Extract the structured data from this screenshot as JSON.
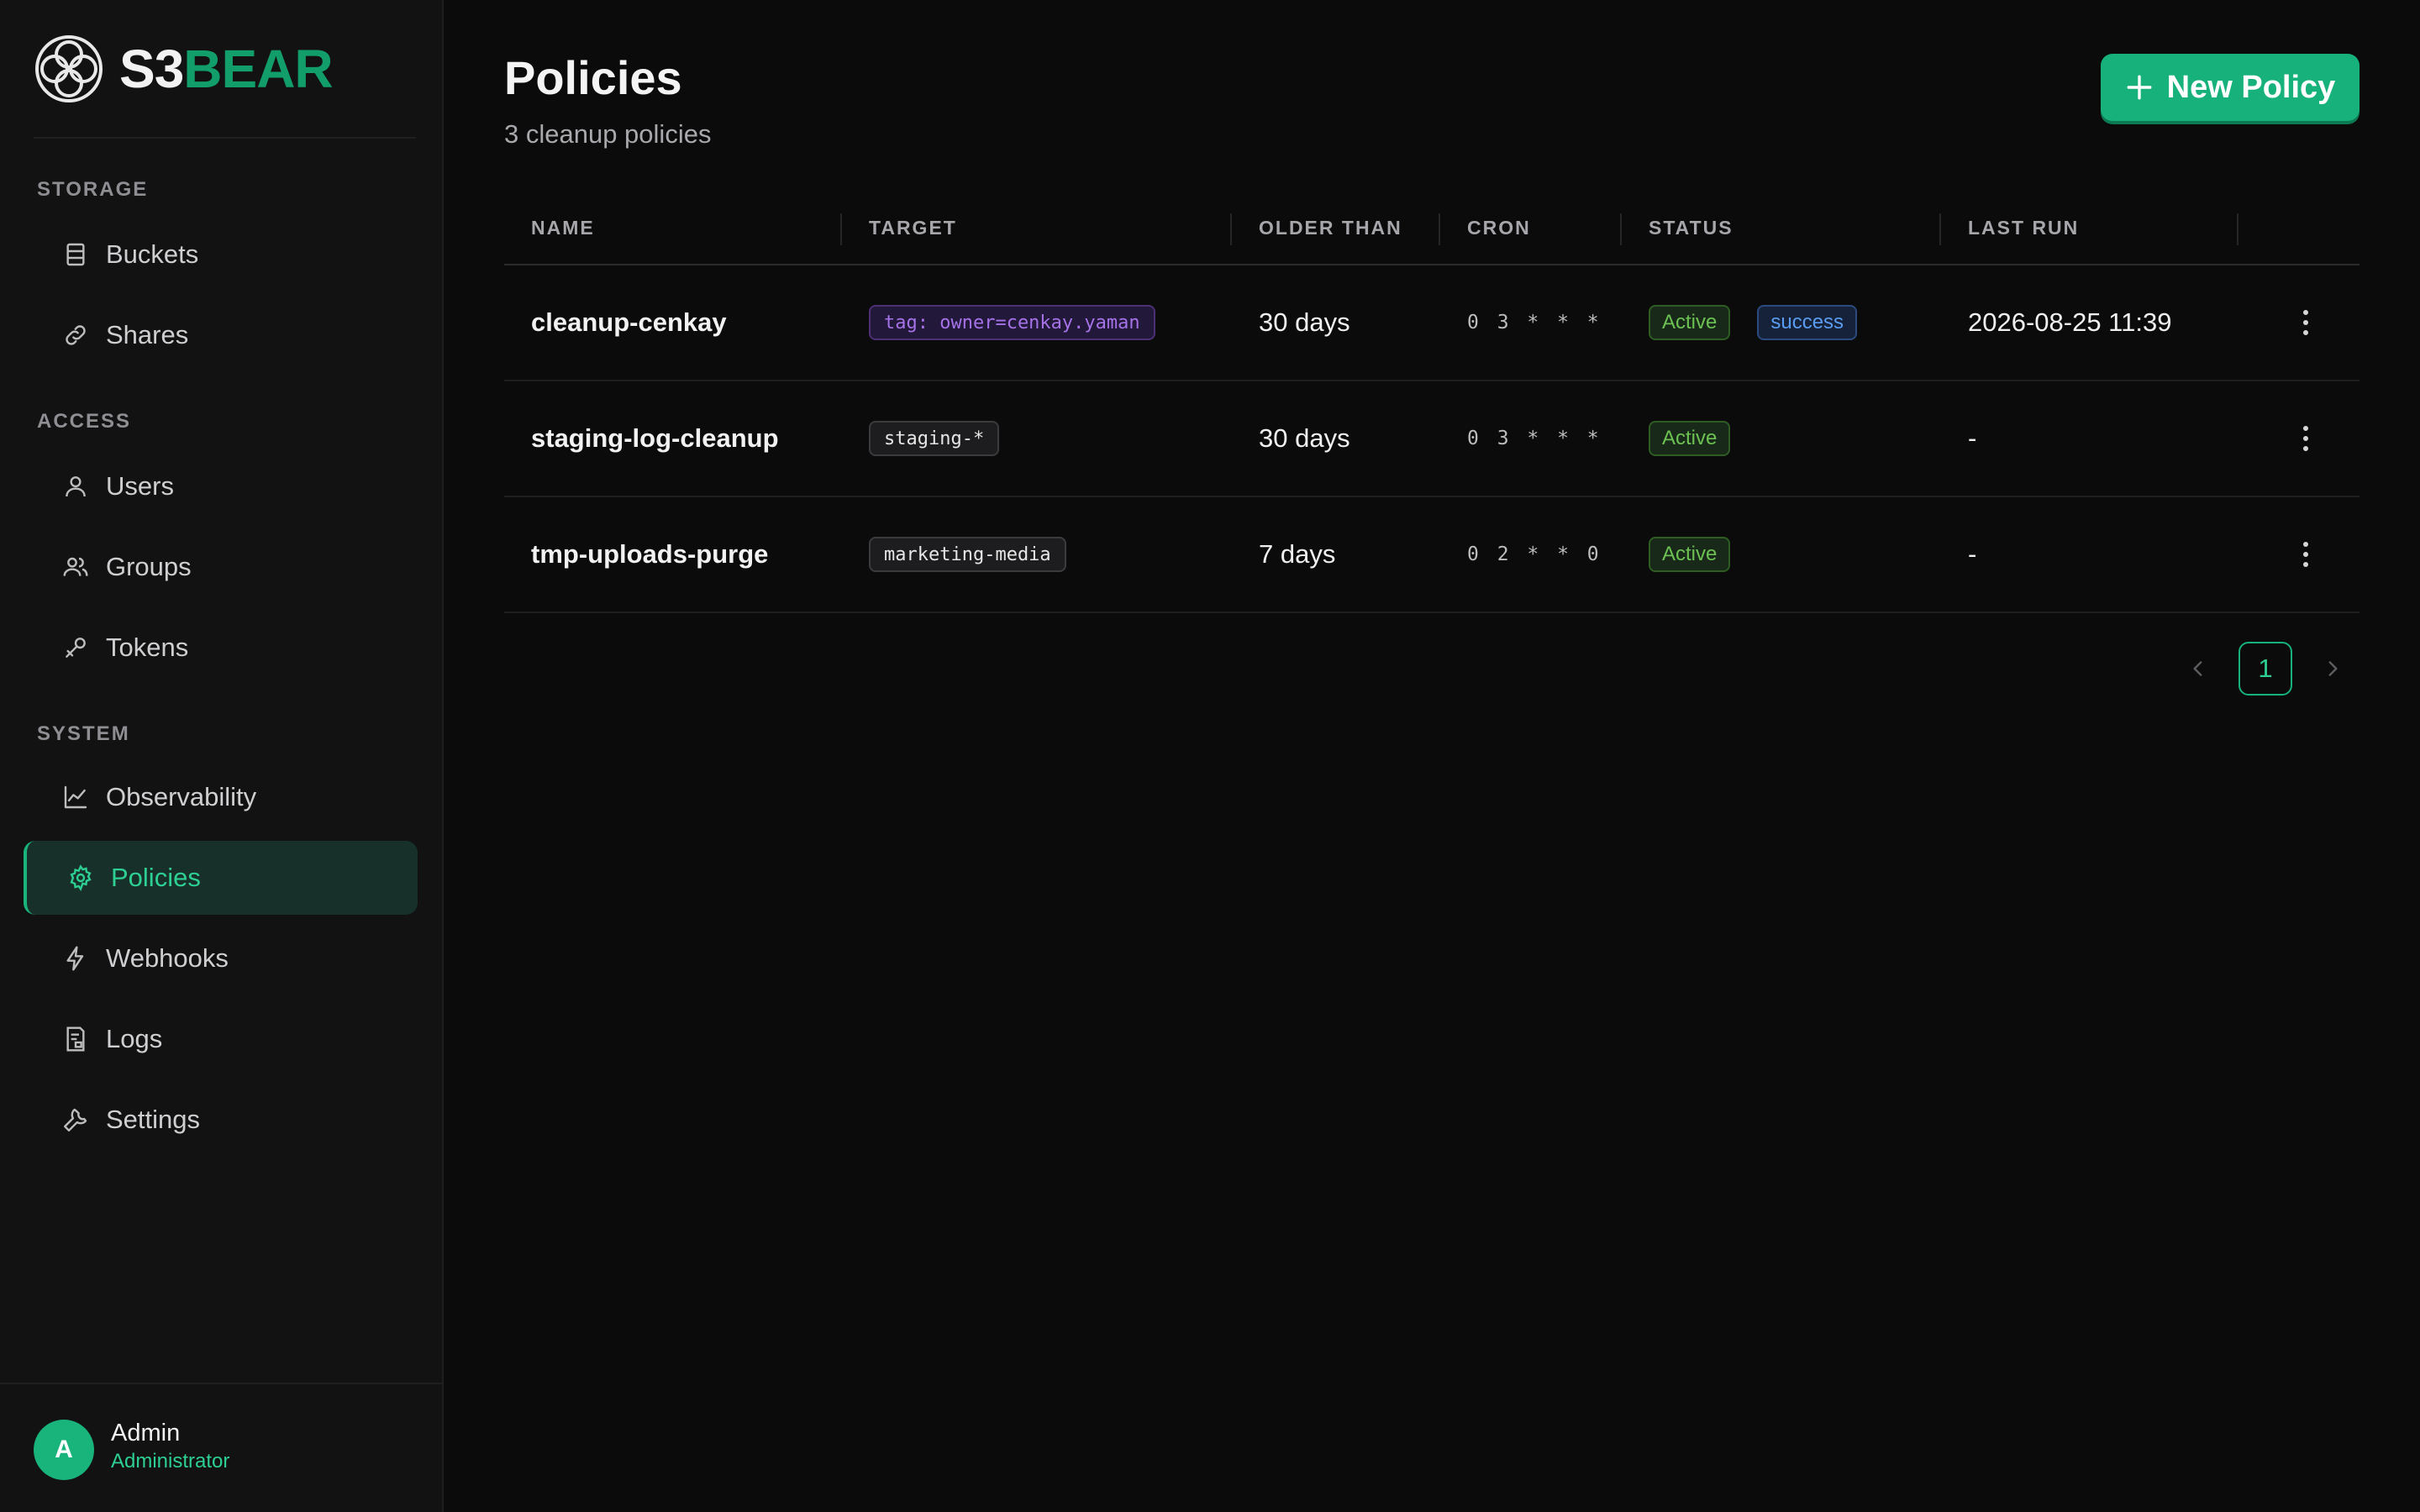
{
  "brand": {
    "name_prefix": "S3",
    "name_suffix": "BEAR"
  },
  "sidebar": {
    "sections": [
      {
        "label": "STORAGE"
      },
      {
        "label": "ACCESS"
      },
      {
        "label": "SYSTEM"
      }
    ],
    "items": [
      {
        "label": "Buckets",
        "icon": "database-icon"
      },
      {
        "label": "Shares",
        "icon": "link-icon"
      },
      {
        "label": "Users",
        "icon": "user-icon"
      },
      {
        "label": "Groups",
        "icon": "users-icon"
      },
      {
        "label": "Tokens",
        "icon": "key-icon"
      },
      {
        "label": "Observability",
        "icon": "chart-line-icon"
      },
      {
        "label": "Policies",
        "icon": "gear-icon",
        "active": true
      },
      {
        "label": "Webhooks",
        "icon": "bolt-icon"
      },
      {
        "label": "Logs",
        "icon": "file-log-icon"
      },
      {
        "label": "Settings",
        "icon": "wrench-icon"
      }
    ],
    "user": {
      "initial": "A",
      "name": "Admin",
      "role": "Administrator"
    }
  },
  "header": {
    "title": "Policies",
    "subtitle": "3 cleanup policies",
    "new_button_label": "New Policy"
  },
  "table": {
    "columns": [
      "NAME",
      "TARGET",
      "OLDER THAN",
      "CRON",
      "STATUS",
      "LAST RUN"
    ],
    "rows": [
      {
        "name": "cleanup-cenkay",
        "target": "tag: owner=cenkay.yaman",
        "target_kind": "tag",
        "older_than": "30 days",
        "cron": "0 3 * * *",
        "status": "Active",
        "last_result": "success",
        "last_run": "2026-08-25 11:39"
      },
      {
        "name": "staging-log-cleanup",
        "target": "staging-*",
        "target_kind": "bucket",
        "older_than": "30 days",
        "cron": "0 3 * * *",
        "status": "Active",
        "last_result": "",
        "last_run": "-"
      },
      {
        "name": "tmp-uploads-purge",
        "target": "marketing-media",
        "target_kind": "bucket",
        "older_than": "7 days",
        "cron": "0 2 * * 0",
        "status": "Active",
        "last_result": "",
        "last_run": "-"
      }
    ]
  },
  "pagination": {
    "current_page": "1"
  },
  "colors": {
    "accent": "#17b27b",
    "active_badge": "#6cc152",
    "success_badge": "#5a9cf0",
    "tag_purple": "#a672e8"
  }
}
